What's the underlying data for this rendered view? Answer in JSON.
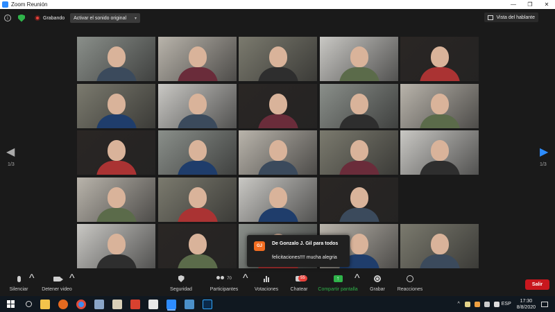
{
  "window": {
    "title": "Zoom Reunión",
    "controls": [
      "—",
      "❐",
      "✕"
    ]
  },
  "topbar": {
    "recording_label": "Grabando",
    "original_sound_label": "Activar el sonido original",
    "speaker_view_label": "Vista del hablante"
  },
  "pagination": {
    "left_indicator": "1/3",
    "right_indicator": "1/3",
    "left_arrow": "◀",
    "right_arrow": "▶"
  },
  "grid": {
    "columns": 5,
    "rows": 5,
    "active_tile_index": 15,
    "tile_colors": [
      "#8a8f8a",
      "#7b7a6e",
      "#2a2624",
      "#b9b4ab",
      "#c9c8c4"
    ]
  },
  "chat_notification": {
    "avatar_initials": "GJ",
    "avatar_color": "#f26d21",
    "from": "De Gonzalo J. Gil para todos",
    "message": "felicitaciones!!!! mucha alegria"
  },
  "controls": {
    "mute": "Silenciar",
    "stop_video": "Detener video",
    "security": "Seguridad",
    "participants": "Participantes",
    "participants_count": "70",
    "polls": "Votaciones",
    "chat": "Chatear",
    "chat_badge": "55",
    "share": "Compartir pantalla",
    "record": "Grabar",
    "reactions": "Reacciones",
    "leave": "Salir"
  },
  "taskbar": {
    "language": "ESP",
    "time": "17:30",
    "date": "8/8/2020"
  },
  "colors": {
    "accent": "#2d8cff",
    "share_green": "#2fb34a",
    "leave_red": "#c8171e",
    "active_border": "#e3e37a"
  }
}
